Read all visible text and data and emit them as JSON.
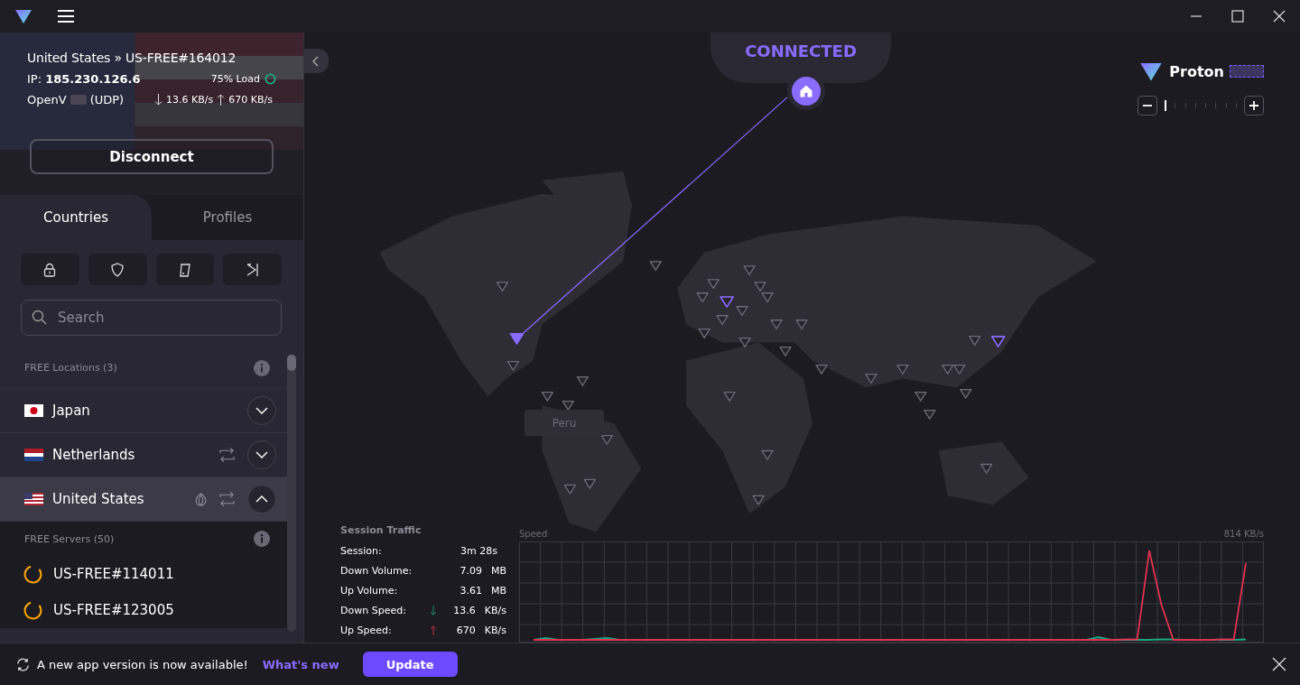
{
  "connection": {
    "location": "United States » US-FREE#164012",
    "ip_label": "IP:",
    "ip": "185.230.126.6",
    "load": "75% Load",
    "protocol_start": "OpenV",
    "protocol_end": "(UDP)",
    "down": "13.6 KB/s",
    "up": "670 KB/s",
    "button": "Disconnect"
  },
  "tabs": [
    {
      "label": "Countries",
      "selected": true
    },
    {
      "label": "Profiles",
      "selected": false
    }
  ],
  "search": {
    "placeholder": "Search"
  },
  "locations": {
    "header": "FREE Locations (3)",
    "countries": [
      {
        "name": "Japan",
        "kind": "jp",
        "tor": false,
        "p2p": false,
        "expanded": false,
        "selected": false
      },
      {
        "name": "Netherlands",
        "kind": "nl",
        "tor": false,
        "p2p": true,
        "expanded": false,
        "selected": false
      },
      {
        "name": "United States",
        "kind": "us",
        "tor": true,
        "p2p": true,
        "expanded": true,
        "selected": true
      }
    ]
  },
  "servers": {
    "header": "FREE Servers (50)",
    "items": [
      {
        "name": "US-FREE#114011"
      },
      {
        "name": "US-FREE#123005"
      }
    ]
  },
  "status": "CONNECTED",
  "logo": "Proton",
  "zoom": {
    "level": 0
  },
  "map_label": "Peru",
  "traffic": {
    "title": "Session Traffic",
    "rows": [
      {
        "label": "Session:",
        "value": "3m 28s",
        "kind": "plain"
      },
      {
        "label": "Down Volume:",
        "value": "7.09",
        "unit": "MB",
        "kind": "plain"
      },
      {
        "label": "Up Volume:",
        "value": "3.61",
        "unit": "MB",
        "kind": "plain"
      },
      {
        "label": "Down Speed:",
        "value": "13.6",
        "unit": "KB/s",
        "kind": "down"
      },
      {
        "label": "Up Speed:",
        "value": "670",
        "unit": "KB/s",
        "kind": "up"
      }
    ],
    "chart_title": "Speed",
    "chart_max": "814 KB/s"
  },
  "notice": {
    "text": "A new app version is now available!",
    "link": "What's new",
    "button": "Update"
  }
}
